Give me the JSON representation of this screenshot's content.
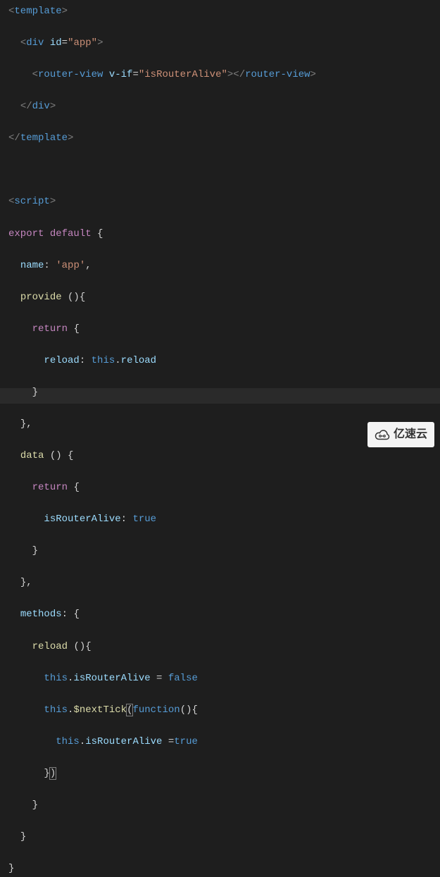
{
  "code": {
    "l1": {
      "b": "<",
      "tag": "template",
      "c": ">"
    },
    "l2": {
      "indent": "  ",
      "b": "<",
      "tag": "div",
      "sp": " ",
      "attr": "id",
      "eq": "=",
      "val": "\"app\"",
      "c": ">"
    },
    "l3": {
      "indent": "    ",
      "b": "<",
      "tag": "router-view",
      "sp": " ",
      "attr": "v-if",
      "eq": "=",
      "val": "\"isRouterAlive\"",
      "c": ">",
      "b2": "</",
      "tag2": "router-view",
      "c2": ">"
    },
    "l4": {
      "indent": "  ",
      "b": "</",
      "tag": "div",
      "c": ">"
    },
    "l5": {
      "b": "</",
      "tag": "template",
      "c": ">"
    },
    "l6": "",
    "l7": {
      "b": "<",
      "tag": "script",
      "c": ">"
    },
    "l8": {
      "kw": "export",
      "sp": " ",
      "kw2": "default",
      "sp2": " ",
      "brace": "{"
    },
    "l9": {
      "indent": "  ",
      "prop": "name",
      "colon": ": ",
      "str": "'app'",
      "comma": ","
    },
    "l10": {
      "indent": "  ",
      "func": "provide",
      "sp": " ",
      "paren": "()",
      "brace": "{"
    },
    "l11": {
      "indent": "    ",
      "kw": "return",
      "sp": " ",
      "brace": "{"
    },
    "l12": {
      "indent": "      ",
      "prop": "reload",
      "colon": ": ",
      "this": "this",
      "dot": ".",
      "prop2": "reload"
    },
    "l13": {
      "indent": "    ",
      "brace": "}"
    },
    "l14": {
      "indent": "  ",
      "brace": "}",
      "comma": ","
    },
    "l15": {
      "indent": "  ",
      "func": "data",
      "sp": " ",
      "paren": "() ",
      "brace": "{"
    },
    "l16": {
      "indent": "    ",
      "kw": "return",
      "sp": " ",
      "brace": "{"
    },
    "l17": {
      "indent": "      ",
      "prop": "isRouterAlive",
      "colon": ": ",
      "bool": "true"
    },
    "l18": {
      "indent": "    ",
      "brace": "}"
    },
    "l19": {
      "indent": "  ",
      "brace": "}",
      "comma": ","
    },
    "l20": {
      "indent": "  ",
      "prop": "methods",
      "colon": ": ",
      "brace": "{"
    },
    "l21": {
      "indent": "    ",
      "func": "reload",
      "sp": " ",
      "paren": "()",
      "brace": "{"
    },
    "l22": {
      "indent": "      ",
      "this": "this",
      "dot": ".",
      "prop": "isRouterAlive",
      "sp": " = ",
      "bool": "false"
    },
    "l23": {
      "indent": "      ",
      "this": "this",
      "dot": ".",
      "func": "$nextTick",
      "paren1": "(",
      "kw": "function",
      "paren2": "()",
      "brace": "{"
    },
    "l24": {
      "indent": "        ",
      "this": "this",
      "dot": ".",
      "prop": "isRouterAlive",
      "sp": " =",
      "bool": "true"
    },
    "l25": {
      "indent": "      ",
      "brace": "}",
      "paren": ")"
    },
    "l26": {
      "indent": "    ",
      "brace": "}"
    },
    "l27": {
      "indent": "  ",
      "brace": "}"
    },
    "l28": {
      "brace": "}"
    }
  },
  "watermark": {
    "text": "亿速云"
  }
}
